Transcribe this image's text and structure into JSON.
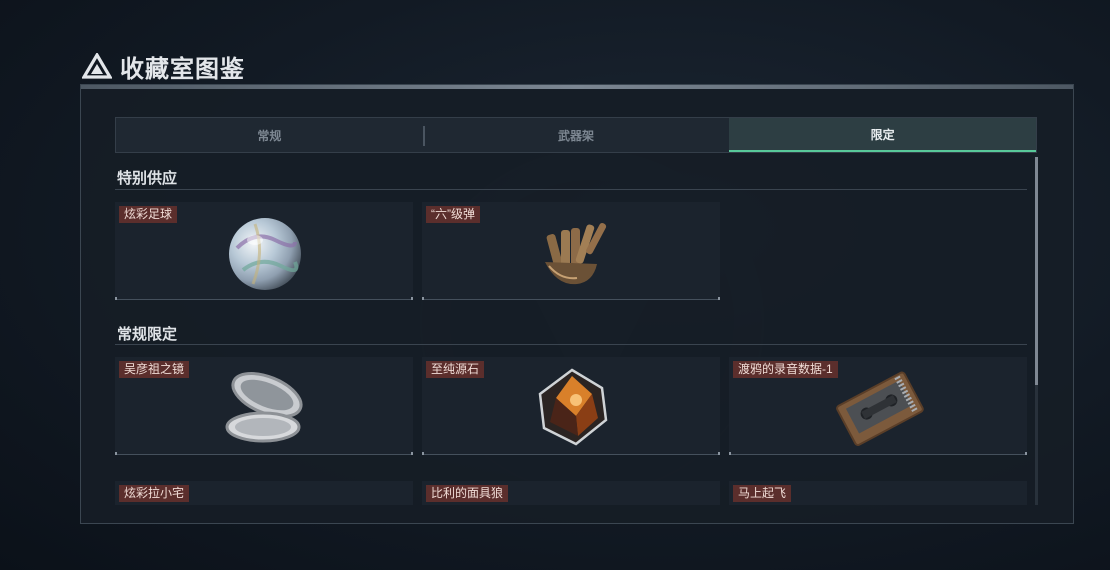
{
  "header": {
    "title": "收藏室图鉴",
    "icon": "triangle-logo-icon"
  },
  "tabs": [
    {
      "label": "常规",
      "active": false
    },
    {
      "label": "武器架",
      "active": false
    },
    {
      "label": "限定",
      "active": true
    }
  ],
  "sections": [
    {
      "title": "特别供应",
      "items": [
        {
          "label": "炫彩足球",
          "icon": "iridescent-ball-icon"
        },
        {
          "label": "“六”级弹",
          "icon": "bullet-hand-icon"
        }
      ]
    },
    {
      "title": "常规限定",
      "items": [
        {
          "label": "吴彦祖之镜",
          "icon": "compact-mirror-icon"
        },
        {
          "label": "至纯源石",
          "icon": "crystal-stone-icon"
        },
        {
          "label": "渡鸦的录音数据-1",
          "icon": "cassette-tape-icon"
        },
        {
          "label": "炫彩拉小宅",
          "icon": "partial-item-icon"
        },
        {
          "label": "比利的面具狼",
          "icon": "partial-item-icon"
        },
        {
          "label": "马上起飞",
          "icon": "partial-item-icon"
        }
      ]
    }
  ],
  "colors": {
    "accent": "#58c99a",
    "label_bg": "#5b2e2c",
    "panel_bg": "#161d26"
  }
}
